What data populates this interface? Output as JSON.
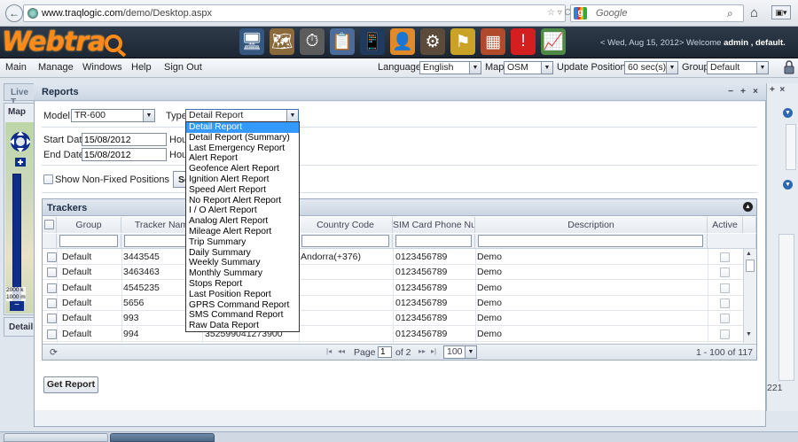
{
  "browser": {
    "url_domain": "www.traqlogic.com",
    "url_path": "/demo/Desktop.aspx",
    "search_placeholder": "Google",
    "search_engine_letter": "g",
    "back_glyph": "←",
    "home_glyph": "⌂"
  },
  "app": {
    "logo": "Webtra",
    "welcome_prefix": "< Wed, Aug 15, 2012> Welcome ",
    "welcome_user": "admin , default.",
    "toolbar_icons": [
      "monitor-icon",
      "map-icon",
      "clock-icon",
      "phone-icon",
      "tracker-icon",
      "person-icon",
      "steering-wheel-icon",
      "flag-icon",
      "geofence-icon",
      "alert-icon",
      "report-chart-icon"
    ],
    "toolbar_glyphs": [
      "🖥",
      "🗺",
      "⏱",
      "📋",
      "📱",
      "👤",
      "⚙",
      "⚑",
      "▦",
      "!",
      "📈"
    ]
  },
  "menu": {
    "items": [
      "Main",
      "Manage",
      "Windows",
      "Help",
      "Sign Out"
    ],
    "language_label": "Language",
    "language_value": "English",
    "map_label": "Map",
    "map_value": "OSM",
    "update_label": "Update Positions",
    "update_value": "60 sec(s)",
    "group_label": "Group",
    "group_value": "Default"
  },
  "left": {
    "live_tab": "Live T",
    "map_label": "Map",
    "scale_top": "2000 k",
    "scale_bottom": "1000 m",
    "detail_tab": "Detail"
  },
  "reports": {
    "title": "Reports",
    "window_buttons": [
      "−",
      "+",
      "×"
    ],
    "outer_buttons": [
      "+",
      "×"
    ],
    "model_label": "Model",
    "model_value": "TR-600",
    "type_label": "Type",
    "type_value": "Detail Report",
    "start_label": "Start Date",
    "start_value": "15/08/2012",
    "end_label": "End Date",
    "end_value": "15/08/2012",
    "hour_label": "Hou",
    "non_fixed_label": "Show Non-Fixed Positions",
    "se_label": "Se",
    "get_report": "Get Report",
    "right_number": "221"
  },
  "type_options": [
    "Detail Report",
    "Detail Report (Summary)",
    "Last Emergency Report",
    "Alert Report",
    "Geofence Alert Report",
    "Ignition Alert Report",
    "Speed Alert Report",
    "No Report Alert Report",
    "I / O Alert Report",
    "Analog Alert Report",
    "Mileage Alert Report",
    "Trip Summary",
    "Daily Summary",
    "Weekly Summary",
    "Monthly Summary",
    "Stops Report",
    "Last Position Report",
    "GPRS Command Report",
    "SMS Command Report",
    "Raw Data Report"
  ],
  "trackers": {
    "title": "Trackers",
    "columns": [
      "Group",
      "Tracker Nam",
      "",
      "Country Code",
      "SIM Card Phone Nu",
      "Description",
      "Active"
    ],
    "rows": [
      {
        "group": "Default",
        "tracker": "3443545",
        "imei": "",
        "country": "Andorra(+376)",
        "sim": "0123456789",
        "description": "Demo"
      },
      {
        "group": "Default",
        "tracker": "3463463",
        "imei": "",
        "country": "",
        "sim": "0123456789",
        "description": "Demo"
      },
      {
        "group": "Default",
        "tracker": "4545235",
        "imei": "",
        "country": "",
        "sim": "0123456789",
        "description": "Demo"
      },
      {
        "group": "Default",
        "tracker": "5656",
        "imei": "",
        "country": "",
        "sim": "0123456789",
        "description": "Demo"
      },
      {
        "group": "Default",
        "tracker": "993",
        "imei": "",
        "country": "",
        "sim": "0123456789",
        "description": "Demo"
      },
      {
        "group": "Default",
        "tracker": "994",
        "imei": "352599041273900",
        "country": "",
        "sim": "0123456789",
        "description": "Demo"
      }
    ],
    "pager": {
      "page_label": "Page",
      "page_value": "1",
      "of_label": "of 2",
      "page_size": "100",
      "summary": "1 - 100 of 117",
      "first": "|◂",
      "prev": "◂◂",
      "next": "▸▸",
      "last": "▸|"
    }
  }
}
